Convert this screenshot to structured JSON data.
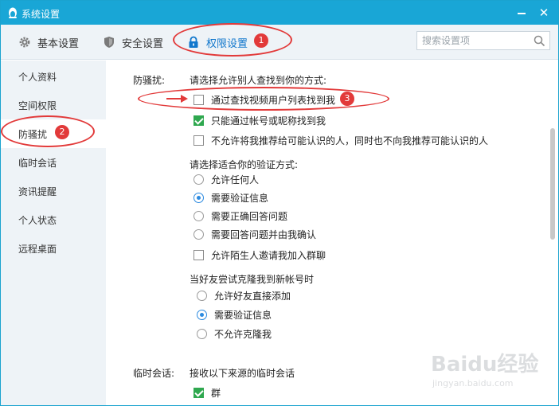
{
  "window": {
    "title": "系统设置"
  },
  "tabs": [
    {
      "label": "基本设置",
      "icon": "gear-icon"
    },
    {
      "label": "安全设置",
      "icon": "shield-icon"
    },
    {
      "label": "权限设置",
      "icon": "lock-icon"
    }
  ],
  "search": {
    "placeholder": "搜索设置项"
  },
  "sidebar": {
    "items": [
      {
        "label": "个人资料"
      },
      {
        "label": "空间权限"
      },
      {
        "label": "防骚扰"
      },
      {
        "label": "临时会话"
      },
      {
        "label": "资讯提醒"
      },
      {
        "label": "个人状态"
      },
      {
        "label": "远程桌面"
      }
    ],
    "active_index": 2
  },
  "content": {
    "anti_harass": {
      "section_label": "防骚扰:",
      "find_me_prompt": "请选择允许别人查找到你的方式:",
      "find_options": [
        {
          "label": "通过查找视频用户列表找到我",
          "checked": false
        },
        {
          "label": "只能通过帐号或昵称找到我",
          "checked": true
        },
        {
          "label": "不允许将我推荐给可能认识的人，同时也不向我推荐可能认识的人",
          "checked": false
        }
      ],
      "verify_prompt": "请选择适合你的验证方式:",
      "verify_options": [
        {
          "label": "允许任何人",
          "selected": false
        },
        {
          "label": "需要验证信息",
          "selected": true
        },
        {
          "label": "需要正确回答问题",
          "selected": false
        },
        {
          "label": "需要回答问题并由我确认",
          "selected": false
        }
      ],
      "group_invite": {
        "label": "允许陌生人邀请我加入群聊",
        "checked": false
      },
      "clone_prompt": "当好友尝试克隆我到新帐号时",
      "clone_options": [
        {
          "label": "允许好友直接添加",
          "selected": false
        },
        {
          "label": "需要验证信息",
          "selected": true
        },
        {
          "label": "不允许克隆我",
          "selected": false
        }
      ]
    },
    "temp_session": {
      "section_label": "临时会话:",
      "prompt": "接收以下来源的临时会话",
      "options": [
        {
          "label": "群",
          "checked": true
        }
      ]
    }
  },
  "annotations": {
    "badges": [
      "1",
      "2",
      "3"
    ],
    "color": "#e23a3a"
  },
  "watermark": {
    "main": "Baidu经验",
    "sub": "jingyan.baidu.com"
  },
  "colors": {
    "titlebar": "#19a6d6",
    "accent": "#1177cc",
    "check": "#2fa84f",
    "radio": "#2d8be0"
  }
}
